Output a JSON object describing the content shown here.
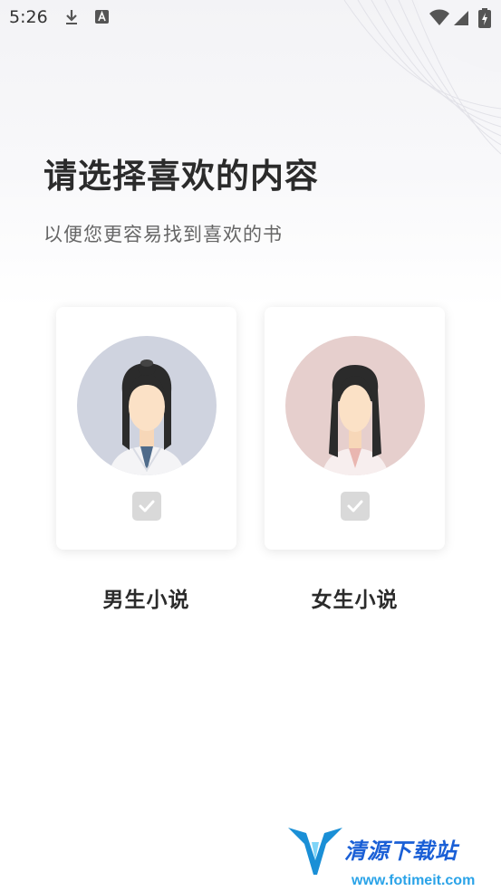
{
  "status_bar": {
    "time": "5:26",
    "icons": [
      "download-icon",
      "a-font-icon",
      "wifi-icon",
      "signal-icon",
      "battery-charging-icon"
    ]
  },
  "page": {
    "title": "请选择喜欢的内容",
    "subtitle": "以便您更容易找到喜欢的书"
  },
  "options": [
    {
      "label": "男生小说",
      "avatar": "male-avatar-icon",
      "avatar_bg": "#cfd3df",
      "checked": false
    },
    {
      "label": "女生小说",
      "avatar": "female-avatar-icon",
      "avatar_bg": "#e6cfcd",
      "checked": false
    }
  ],
  "watermark": {
    "name": "清源下载站",
    "url": "www.fotimeit.com"
  },
  "colors": {
    "checkbox_bg": "#d9d9d9",
    "title": "#2b2b2b",
    "subtitle": "#666666",
    "watermark_blue": "#1a5fd6"
  }
}
